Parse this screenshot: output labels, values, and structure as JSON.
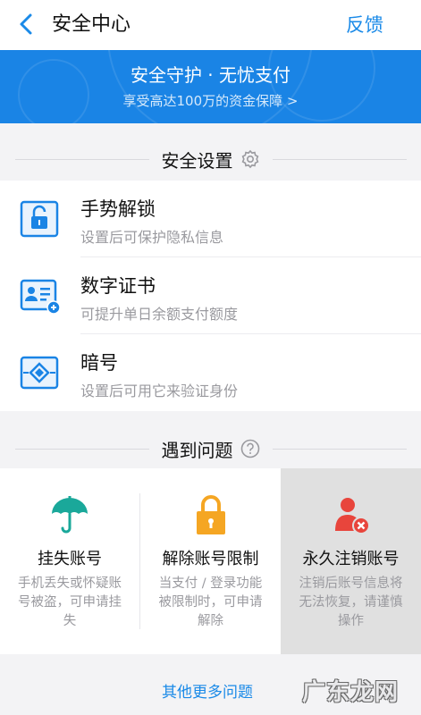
{
  "header": {
    "title": "安全中心",
    "feedback_label": "反馈",
    "back_icon": "chevron-left-icon"
  },
  "banner": {
    "title": "安全守护 · 无忧支付",
    "subtitle": "享受高达100万的资金保障 >"
  },
  "security_settings": {
    "heading": "安全设置",
    "heading_icon": "gear-icon",
    "items": [
      {
        "title": "手势解锁",
        "subtitle": "设置后可保护隐私信息",
        "icon": "gesture-lock-icon"
      },
      {
        "title": "数字证书",
        "subtitle": "可提升单日余额支付额度",
        "icon": "digital-certificate-icon"
      },
      {
        "title": "暗号",
        "subtitle": "设置后可用它来验证身份",
        "icon": "secret-code-icon"
      }
    ]
  },
  "problems": {
    "heading": "遇到问题",
    "heading_icon": "question-icon",
    "cards": [
      {
        "title": "挂失账号",
        "desc": "手机丢失或怀疑账号被盗，可申请挂失",
        "icon": "umbrella-icon",
        "color": "#1aa89a"
      },
      {
        "title": "解除账号限制",
        "desc": "当支付 / 登录功能被限制时，可申请解除",
        "icon": "padlock-icon",
        "color": "#f5a623"
      },
      {
        "title": "永久注销账号",
        "desc": "注销后账号信息将无法恢复，请谨慎操作",
        "icon": "delete-user-icon",
        "color": "#e8453c"
      }
    ]
  },
  "more_link": "其他更多问题",
  "watermark": "广东龙网",
  "colors": {
    "accent": "#1a8ae8",
    "banner": "#1a84e5"
  }
}
